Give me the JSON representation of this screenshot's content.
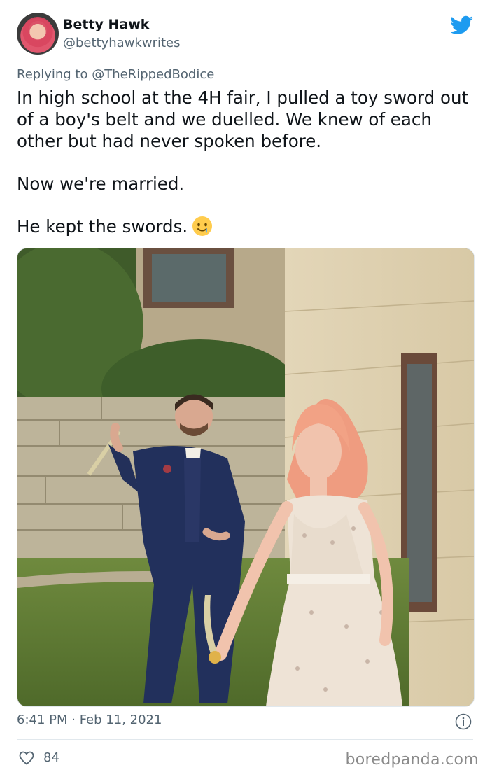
{
  "author": {
    "name": "Betty Hawk",
    "handle": "@bettyhawkwrites"
  },
  "reply": {
    "prefix": "Replying to ",
    "target": "@TheRippedBodice"
  },
  "tweet": {
    "line1": "In high school at the 4H fair, I pulled a toy sword out of a boy's belt and we duelled. We knew of each other but had never spoken before.",
    "line2": "Now we're married.",
    "line3": "He kept the swords."
  },
  "meta": {
    "timestamp": "6:41 PM · Feb 11, 2021",
    "likes": "84"
  },
  "watermark": "boredpanda.com",
  "icons": {
    "platform": "twitter-bird-icon",
    "emoji": "smiling-face-with-tear-icon",
    "info": "info-icon",
    "like": "heart-icon"
  },
  "colors": {
    "brand": "#1d9bf0",
    "muted": "#536471",
    "text": "#0f1419"
  }
}
